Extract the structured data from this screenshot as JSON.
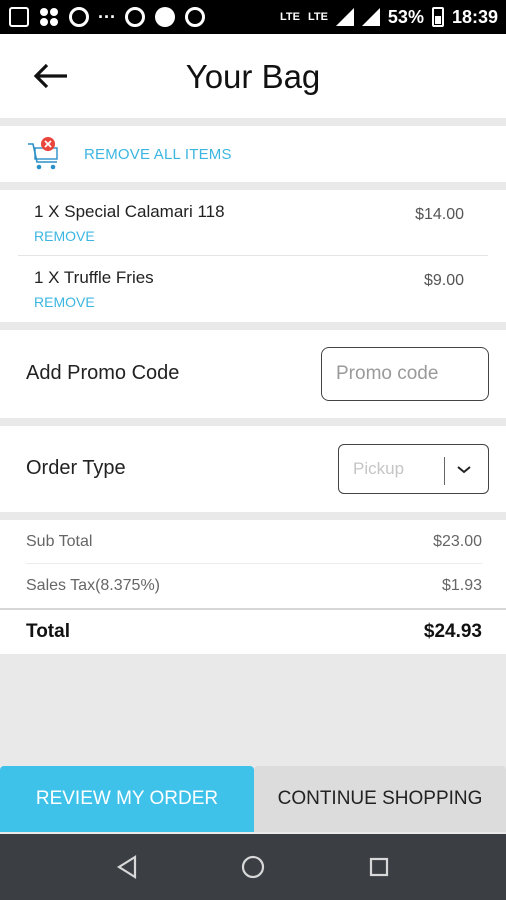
{
  "status_bar": {
    "battery": "53%",
    "time": "18:39",
    "signal_label_1": "LTE",
    "signal_label_2": "LTE"
  },
  "header": {
    "title": "Your Bag"
  },
  "cart_actions": {
    "remove_all_label": "REMOVE ALL ITEMS"
  },
  "items": [
    {
      "name": "1 X Special Calamari 118",
      "remove_label": "REMOVE",
      "price": "$14.00"
    },
    {
      "name": "1 X Truffle Fries",
      "remove_label": "REMOVE",
      "price": "$9.00"
    }
  ],
  "promo": {
    "label": "Add Promo Code",
    "placeholder": "Promo code",
    "value": ""
  },
  "order_type": {
    "label": "Order Type",
    "selected": "Pickup"
  },
  "totals": {
    "subtotal_label": "Sub Total",
    "subtotal_value": "$23.00",
    "tax_label": "Sales Tax(8.375%)",
    "tax_value": "$1.93",
    "total_label": "Total",
    "total_value": "$24.93"
  },
  "buttons": {
    "review": "REVIEW MY ORDER",
    "continue": "CONTINUE SHOPPING"
  },
  "colors": {
    "accent": "#3ec2ea",
    "link": "#3cb6e0",
    "remove_badge": "#e8453c"
  },
  "icons": {
    "back": "arrow-left-icon",
    "cart": "cart-remove-icon",
    "chevron": "chevron-down-icon",
    "nav_back": "nav-back-triangle-icon",
    "nav_home": "nav-home-circle-icon",
    "nav_recents": "nav-recents-square-icon"
  }
}
